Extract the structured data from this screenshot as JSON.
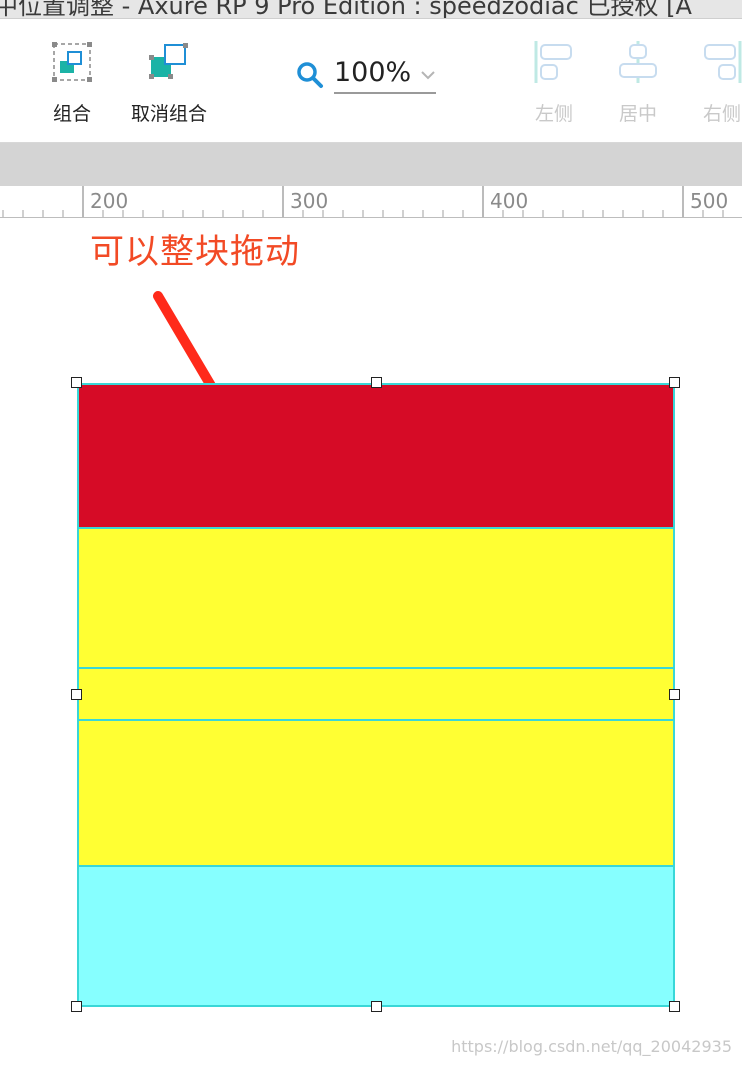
{
  "window": {
    "title": "中位置调整 - Axure RP 9 Pro Edition : speedzodiac 已授权 [A"
  },
  "toolbar": {
    "group_label": "组合",
    "ungroup_label": "取消组合",
    "zoom_value": "100%",
    "align_left_label": "左侧",
    "align_center_label": "居中",
    "align_right_label": "右侧"
  },
  "ruler": {
    "labels": [
      "200",
      "300",
      "400",
      "500"
    ]
  },
  "canvas": {
    "annotation": "可以整块拖动",
    "watermark": "https://blog.csdn.net/qq_20042935",
    "blocks": [
      {
        "name": "red-block",
        "color": "#d60b26"
      },
      {
        "name": "yellow-block-1",
        "color": "#ffff33"
      },
      {
        "name": "yellow-block-2",
        "color": "#ffff33"
      },
      {
        "name": "yellow-block-3",
        "color": "#ffff33"
      },
      {
        "name": "cyan-block",
        "color": "#86ffff"
      }
    ],
    "selection_border_color": "#39d7d7",
    "arrow_color": "#ff2a1a"
  },
  "colors": {
    "accent": "#1f8fd6",
    "disabled": "#c9c9c9"
  }
}
